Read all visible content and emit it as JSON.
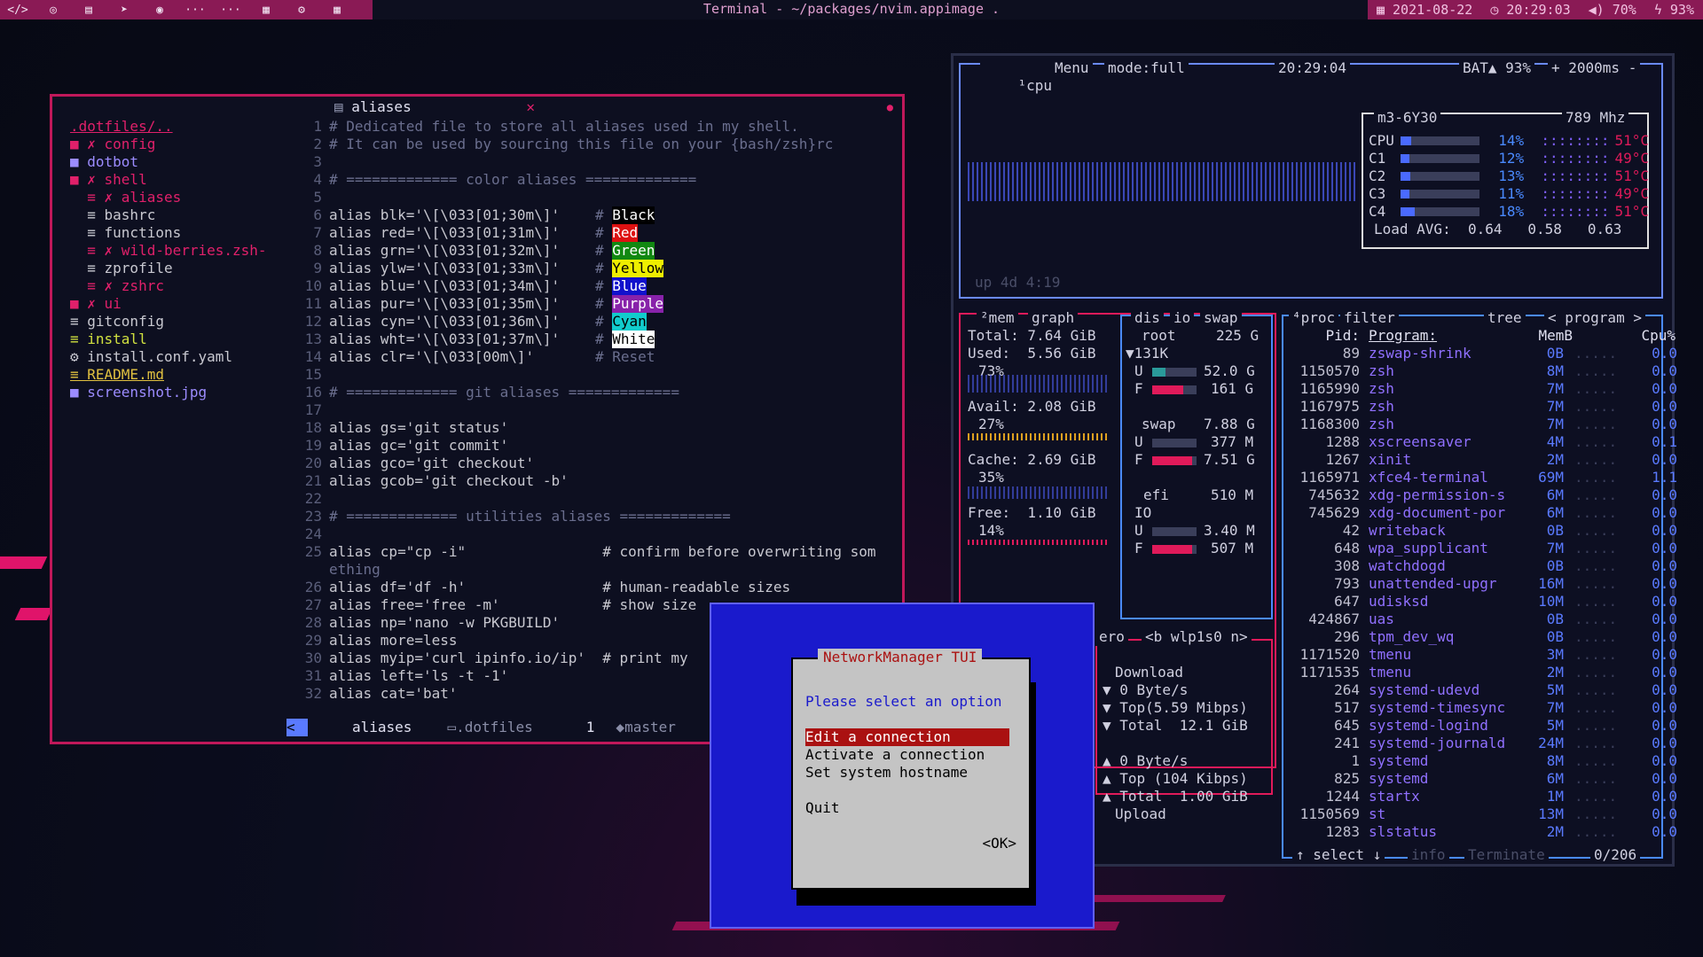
{
  "topbar": {
    "workspaces": [
      "</>",
      "◎",
      "▤",
      "➤",
      "◉",
      "···",
      "···",
      "▦",
      "⚙",
      "▦"
    ],
    "title": "Terminal - ~/packages/nvim.appimage .",
    "date": "2021-08-22",
    "time": "20:29:03",
    "volume": "70%",
    "battery": "93%"
  },
  "nvim": {
    "tab_label": "aliases",
    "tree": [
      {
        "text": ".dotfiles/..",
        "color": "#e0206a",
        "underline": true
      },
      {
        "text": "■ ✗ config",
        "color": "#e0206a"
      },
      {
        "text": "■ dotbot",
        "color": "#9c8cff"
      },
      {
        "text": "■ ✗ shell",
        "color": "#e0206a"
      },
      {
        "text": "  ≡ ✗ aliases",
        "color": "#e0206a"
      },
      {
        "text": "  ≡ bashrc",
        "color": "#c8c8d0"
      },
      {
        "text": "  ≡ functions",
        "color": "#c8c8d0"
      },
      {
        "text": "  ≡ ✗ wild-berries.zsh-",
        "color": "#e0206a"
      },
      {
        "text": "  ≡ zprofile",
        "color": "#c8c8d0"
      },
      {
        "text": "  ≡ ✗ zshrc",
        "color": "#e0206a"
      },
      {
        "text": "■ ✗ ui",
        "color": "#e0206a"
      },
      {
        "text": "≡ gitconfig",
        "color": "#c8c8d0"
      },
      {
        "text": "≡ install",
        "color": "#d0e040"
      },
      {
        "text": "⚙ install.conf.yaml",
        "color": "#c8c8d0"
      },
      {
        "text": "≡ README.md",
        "color": "#e0c040",
        "underline": true
      },
      {
        "text": "■ screenshot.jpg",
        "color": "#9c8cff"
      }
    ],
    "code": [
      {
        "n": "1",
        "t": "# Dedicated file to store all aliases used in my shell.",
        "k": "cmt"
      },
      {
        "n": "2",
        "t": "# It can be used by sourcing this file on your {bash/zsh}rc",
        "k": "cmt"
      },
      {
        "n": "3",
        "t": "",
        "k": "ct"
      },
      {
        "n": "4",
        "t": "# ============= color aliases =============",
        "k": "cmt"
      },
      {
        "n": "5",
        "t": "",
        "k": "ct"
      },
      {
        "n": "6",
        "t": "alias blk='\\[\\033[01;30m\\]'",
        "c": "Black",
        "bg": "#000000",
        "fg": "#ffffff"
      },
      {
        "n": "7",
        "t": "alias red='\\[\\033[01;31m\\]'",
        "c": "Red",
        "bg": "#dd1111",
        "fg": "#ffffff"
      },
      {
        "n": "8",
        "t": "alias grn='\\[\\033[01;32m\\]'",
        "c": "Green",
        "bg": "#118811",
        "fg": "#ffffff"
      },
      {
        "n": "9",
        "t": "alias ylw='\\[\\033[01;33m\\]'",
        "c": "Yellow",
        "bg": "#eeee00",
        "fg": "#000000"
      },
      {
        "n": "10",
        "t": "alias blu='\\[\\033[01;34m\\]'",
        "c": "Blue",
        "bg": "#1111cc",
        "fg": "#ffffff"
      },
      {
        "n": "11",
        "t": "alias pur='\\[\\033[01;35m\\]'",
        "c": "Purple",
        "bg": "#8822aa",
        "fg": "#ffffff"
      },
      {
        "n": "12",
        "t": "alias cyn='\\[\\033[01;36m\\]'",
        "c": "Cyan",
        "bg": "#11cccc",
        "fg": "#000000"
      },
      {
        "n": "13",
        "t": "alias wht='\\[\\033[01;37m\\]'",
        "c": "White",
        "bg": "#ffffff",
        "fg": "#000000"
      },
      {
        "n": "14",
        "t": "alias clr='\\[\\033[00m\\]'",
        "c": "Reset",
        "bg": "",
        "fg": "#6a6e8e"
      },
      {
        "n": "15",
        "t": "",
        "k": "ct"
      },
      {
        "n": "16",
        "t": "# ============= git aliases =============",
        "k": "cmt"
      },
      {
        "n": "17",
        "t": "",
        "k": "ct"
      },
      {
        "n": "18",
        "t": "alias gs='git status'",
        "k": "ct"
      },
      {
        "n": "19",
        "t": "alias gc='git commit'",
        "k": "ct"
      },
      {
        "n": "20",
        "t": "alias gco='git checkout'",
        "k": "ct"
      },
      {
        "n": "21",
        "t": "alias gcob='git checkout -b'",
        "k": "ct"
      },
      {
        "n": "22",
        "t": "",
        "k": "ct"
      },
      {
        "n": "23",
        "t": "# ============= utilities aliases =============",
        "k": "cmt"
      },
      {
        "n": "24",
        "t": "",
        "k": "ct"
      },
      {
        "n": "25",
        "t": "alias cp=\"cp -i\"                # confirm before overwriting som",
        "k": "ct"
      },
      {
        "n": "",
        "t": "ething",
        "k": "cmt"
      },
      {
        "n": "26",
        "t": "alias df='df -h'                # human-readable sizes",
        "k": "ct"
      },
      {
        "n": "27",
        "t": "alias free='free -m'            # show size",
        "k": "ct"
      },
      {
        "n": "28",
        "t": "alias np='nano -w PKGBUILD'",
        "k": "ct"
      },
      {
        "n": "29",
        "t": "alias more=less",
        "k": "ct"
      },
      {
        "n": "30",
        "t": "alias myip='curl ipinfo.io/ip'  # print my",
        "k": "ct"
      },
      {
        "n": "31",
        "t": "alias left='ls -t -1'",
        "k": "ct"
      },
      {
        "n": "32",
        "t": "alias cat='bat'",
        "k": "ct"
      }
    ],
    "status": {
      "file": "aliases",
      "dir": ".dotfiles",
      "num": "1",
      "branch": "master"
    }
  },
  "btop": {
    "cpu_header": [
      "¹cpu",
      "Menu",
      "mode:full",
      "20:29:04",
      "BAT▲ 93%",
      "+ 2000ms -"
    ],
    "cpu_model": "m3-6Y30",
    "cpu_freq": "789 Mhz",
    "cores": [
      {
        "name": "CPU",
        "pct": "14%",
        "temp": "51°C",
        "level": 0.14
      },
      {
        "name": "C1",
        "pct": "12%",
        "temp": "49°C",
        "level": 0.12
      },
      {
        "name": "C2",
        "pct": "13%",
        "temp": "51°C",
        "level": 0.13
      },
      {
        "name": "C3",
        "pct": "11%",
        "temp": "49°C",
        "level": 0.11
      },
      {
        "name": "C4",
        "pct": "18%",
        "temp": "51°C",
        "level": 0.18
      }
    ],
    "load_avg": "Load AVG:  0.64   0.58   0.63",
    "uptime": "up 4d 4:19",
    "mem": {
      "header": "²mem",
      "graph_label": "graph",
      "total": "Total: 7.64 GiB",
      "used": "Used:  5.56 GiB",
      "used_pct": "73%",
      "avail": "Avail: 2.08 GiB",
      "avail_pct": "27%",
      "cache": "Cache: 2.69 GiB",
      "cache_pct": "35%",
      "free": "Free:  1.10 GiB",
      "free_pct": "14%"
    },
    "disks": {
      "header": "dis",
      "io": "io",
      "swap_label": "swap",
      "root": "root",
      "root_size": "225 G",
      "root_io": "▼131K",
      "u1": "52.0 G",
      "f1": "161 G",
      "swap": "swap",
      "swap_size": "7.88 G",
      "u2": "377 M",
      "f2": "7.51 G",
      "efi": "efi",
      "efi_size": "510 M",
      "io_label": "IO",
      "u3": "3.40 M",
      "f3": "507 M"
    },
    "net": {
      "header": "ero",
      "iface": "<b wlp1s0 n>",
      "download": "Download",
      "down_rate": "▼ 0 Byte/s",
      "down_top": "▼ Top(5.59 Mibps)",
      "down_total": "▼ Total  12.1 GiB",
      "up_rate": "▲ 0 Byte/s",
      "up_top": "▲ Top (104 Kibps)",
      "up_total": "▲ Total  1.00 GiB",
      "upload": "Upload"
    },
    "proc": {
      "header": "⁴proc",
      "filter": "filter",
      "tree": "tree",
      "sort": "< program >",
      "col_pid": "Pid:",
      "col_prog": "Program:",
      "col_mem": "MemB",
      "col_cpu": "Cpu%",
      "rows": [
        [
          "89",
          "zswap-shrink",
          "0B",
          "0.0"
        ],
        [
          "1150570",
          "zsh",
          "8M",
          "0.0"
        ],
        [
          "1165990",
          "zsh",
          "7M",
          "0.0"
        ],
        [
          "1167975",
          "zsh",
          "7M",
          "0.0"
        ],
        [
          "1168300",
          "zsh",
          "7M",
          "0.0"
        ],
        [
          "1288",
          "xscreensaver",
          "4M",
          "0.1"
        ],
        [
          "1267",
          "xinit",
          "2M",
          "0.0"
        ],
        [
          "1165971",
          "xfce4-terminal",
          "69M",
          "1.1"
        ],
        [
          "745632",
          "xdg-permission-s",
          "6M",
          "0.0"
        ],
        [
          "745629",
          "xdg-document-por",
          "6M",
          "0.0"
        ],
        [
          "42",
          "writeback",
          "0B",
          "0.0"
        ],
        [
          "648",
          "wpa_supplicant",
          "7M",
          "0.0"
        ],
        [
          "308",
          "watchdogd",
          "0B",
          "0.0"
        ],
        [
          "793",
          "unattended-upgr",
          "16M",
          "0.0"
        ],
        [
          "647",
          "udisksd",
          "10M",
          "0.0"
        ],
        [
          "424867",
          "uas",
          "0B",
          "0.0"
        ],
        [
          "296",
          "tpm_dev_wq",
          "0B",
          "0.0"
        ],
        [
          "1171520",
          "tmenu",
          "3M",
          "0.0"
        ],
        [
          "1171535",
          "tmenu",
          "2M",
          "0.0"
        ],
        [
          "264",
          "systemd-udevd",
          "5M",
          "0.0"
        ],
        [
          "517",
          "systemd-timesync",
          "7M",
          "0.0"
        ],
        [
          "645",
          "systemd-logind",
          "5M",
          "0.0"
        ],
        [
          "241",
          "systemd-journald",
          "24M",
          "0.0"
        ],
        [
          "1",
          "systemd",
          "8M",
          "0.0"
        ],
        [
          "825",
          "systemd",
          "6M",
          "0.0"
        ],
        [
          "1244",
          "startx",
          "1M",
          "0.0"
        ],
        [
          "1150569",
          "st",
          "13M",
          "0.0"
        ],
        [
          "1283",
          "slstatus",
          "2M",
          "0.0"
        ]
      ],
      "footer_select": "↑ select ↓",
      "footer_info": "info",
      "footer_terminate": "Terminate",
      "footer_count": "0/206"
    }
  },
  "nmtui": {
    "title": "NetworkManager TUI",
    "prompt": "Please select an option",
    "options": [
      "Edit a connection",
      "Activate a connection",
      "Set system hostname"
    ],
    "quit": "Quit",
    "ok": "<OK>"
  }
}
